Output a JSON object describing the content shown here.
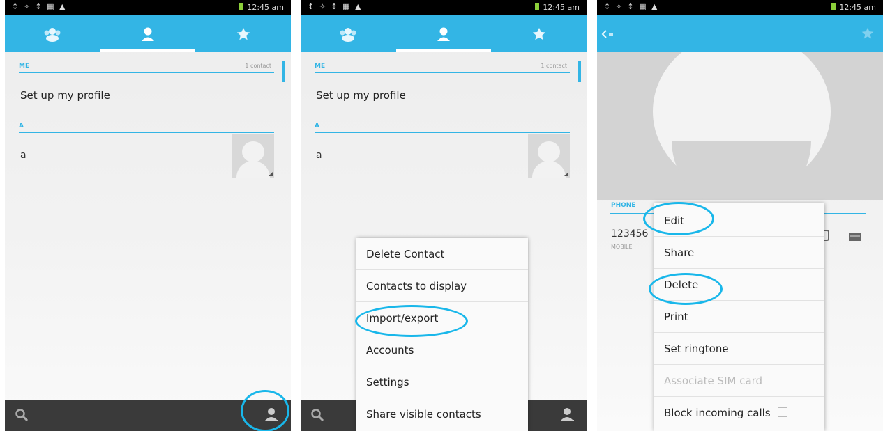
{
  "status": {
    "left_icons": "↕ ✧ ↕ ▦ ▲",
    "time": "12:45 am"
  },
  "panel1": {
    "section_me": "ME",
    "me_count": "1 contact",
    "profile_row": "Set up my profile",
    "section_a": "A",
    "contact_name": "a"
  },
  "panel2": {
    "section_me": "ME",
    "me_count": "1 contact",
    "profile_row": "Set up my profile",
    "section_a": "A",
    "contact_name": "a",
    "menu_items": [
      "Delete Contact",
      "Contacts to display",
      "Import/export",
      "Accounts",
      "Settings",
      "Share visible contacts"
    ]
  },
  "panel3": {
    "section_phone": "PHONE",
    "phone_number": "123456",
    "phone_type": "MOBILE",
    "menu_items": [
      "Edit",
      "Share",
      "Delete",
      "Print",
      "Set ringtone",
      "Associate SIM card",
      "Block incoming calls"
    ]
  },
  "icons": [
    "groups-icon",
    "person-icon",
    "star-icon",
    "search-icon",
    "add-contact-icon",
    "back-icon",
    "call-icon",
    "message-icon"
  ],
  "colors": {
    "accent": "#33b5e5",
    "highlight": "#19b7ea",
    "bottom_bar": "#3a3a3a"
  }
}
